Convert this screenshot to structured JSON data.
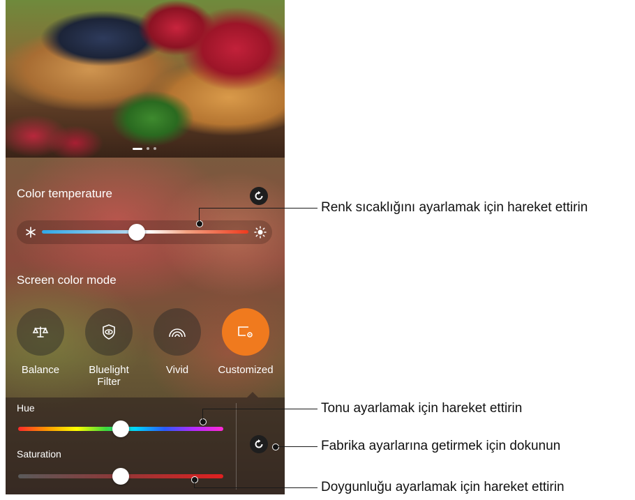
{
  "panel": {
    "color_temperature_title": "Color temperature",
    "temp_left_icon": "snowflake-icon",
    "temp_right_icon": "sun-icon",
    "temp_level": 0.46,
    "screen_color_mode_title": "Screen color mode",
    "modes": [
      {
        "label": "Balance",
        "icon": "scale-icon",
        "selected": false
      },
      {
        "label": "Bluelight Filter",
        "icon": "eye-shield-icon",
        "selected": false
      },
      {
        "label": "Vivid",
        "icon": "rainbow-icon",
        "selected": false
      },
      {
        "label": "Customized",
        "icon": "custom-display-icon",
        "selected": true
      }
    ],
    "hue_label": "Hue",
    "hue_level": 0.5,
    "saturation_label": "Saturation",
    "saturation_level": 0.5,
    "accent_color": "#f07a1e"
  },
  "callouts": {
    "temperature": "Renk sıcaklığını ayarlamak için hareket ettirin",
    "hue": "Tonu ayarlamak için hareket ettirin",
    "reset": "Fabrika ayarlarına getirmek için dokunun",
    "saturation": "Doygunluğu ayarlamak için hareket ettirin"
  }
}
